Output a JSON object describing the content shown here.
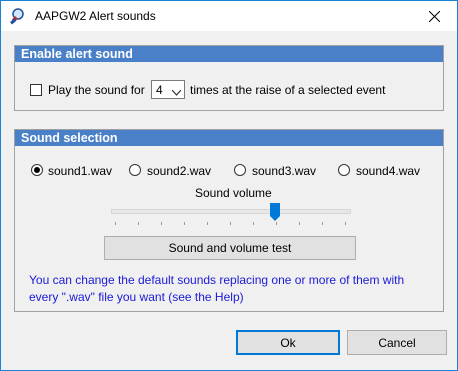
{
  "window": {
    "title": "AAPGW2 Alert sounds"
  },
  "alert": {
    "header": "Enable alert sound",
    "checkbox_checked": false,
    "label_before": "Play the sound for",
    "times_value": "4",
    "label_after": "times at the raise of a selected event"
  },
  "sound": {
    "header": "Sound selection",
    "options": [
      "sound1.wav",
      "sound2.wav",
      "sound3.wav",
      "sound4.wav"
    ],
    "selected_index": 0,
    "volume_label": "Sound volume",
    "volume_level": 0.7,
    "test_button": "Sound and volume  test",
    "info_line1": "You can  change the default sounds replacing one  or more of them  with",
    "info_line2": "every  \".wav\"  file you want  (see the Help)"
  },
  "footer": {
    "ok": "Ok",
    "cancel": "Cancel"
  }
}
